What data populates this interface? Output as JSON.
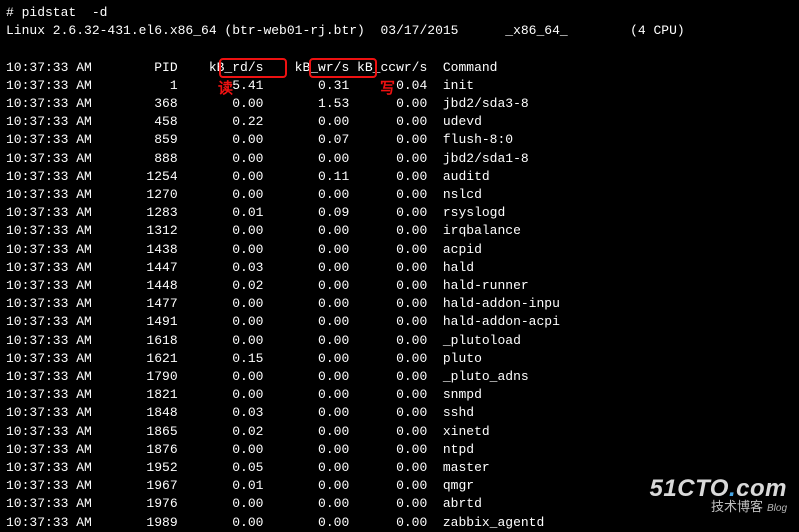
{
  "cmd": "# pidstat  -d",
  "sysline": {
    "kernel": "Linux 2.6.32-431.el6.x86_64 (btr-web01-rj.btr)",
    "date": "03/17/2015",
    "arch": "_x86_64_",
    "cpus": "(4 CPU)"
  },
  "columns": [
    "",
    "",
    "PID",
    "kB_rd/s",
    "kB_wr/s",
    "kB_ccwr/s",
    "Command"
  ],
  "annotations": {
    "read": "读",
    "write": "写"
  },
  "rows": [
    {
      "time": "10:37:33",
      "ampm": "AM",
      "pid": "1",
      "rd": "5.41",
      "wr": "0.31",
      "ccwr": "0.04",
      "cmd": "init"
    },
    {
      "time": "10:37:33",
      "ampm": "AM",
      "pid": "368",
      "rd": "0.00",
      "wr": "1.53",
      "ccwr": "0.00",
      "cmd": "jbd2/sda3-8"
    },
    {
      "time": "10:37:33",
      "ampm": "AM",
      "pid": "458",
      "rd": "0.22",
      "wr": "0.00",
      "ccwr": "0.00",
      "cmd": "udevd"
    },
    {
      "time": "10:37:33",
      "ampm": "AM",
      "pid": "859",
      "rd": "0.00",
      "wr": "0.07",
      "ccwr": "0.00",
      "cmd": "flush-8:0"
    },
    {
      "time": "10:37:33",
      "ampm": "AM",
      "pid": "888",
      "rd": "0.00",
      "wr": "0.00",
      "ccwr": "0.00",
      "cmd": "jbd2/sda1-8"
    },
    {
      "time": "10:37:33",
      "ampm": "AM",
      "pid": "1254",
      "rd": "0.00",
      "wr": "0.11",
      "ccwr": "0.00",
      "cmd": "auditd"
    },
    {
      "time": "10:37:33",
      "ampm": "AM",
      "pid": "1270",
      "rd": "0.00",
      "wr": "0.00",
      "ccwr": "0.00",
      "cmd": "nslcd"
    },
    {
      "time": "10:37:33",
      "ampm": "AM",
      "pid": "1283",
      "rd": "0.01",
      "wr": "0.09",
      "ccwr": "0.00",
      "cmd": "rsyslogd"
    },
    {
      "time": "10:37:33",
      "ampm": "AM",
      "pid": "1312",
      "rd": "0.00",
      "wr": "0.00",
      "ccwr": "0.00",
      "cmd": "irqbalance"
    },
    {
      "time": "10:37:33",
      "ampm": "AM",
      "pid": "1438",
      "rd": "0.00",
      "wr": "0.00",
      "ccwr": "0.00",
      "cmd": "acpid"
    },
    {
      "time": "10:37:33",
      "ampm": "AM",
      "pid": "1447",
      "rd": "0.03",
      "wr": "0.00",
      "ccwr": "0.00",
      "cmd": "hald"
    },
    {
      "time": "10:37:33",
      "ampm": "AM",
      "pid": "1448",
      "rd": "0.02",
      "wr": "0.00",
      "ccwr": "0.00",
      "cmd": "hald-runner"
    },
    {
      "time": "10:37:33",
      "ampm": "AM",
      "pid": "1477",
      "rd": "0.00",
      "wr": "0.00",
      "ccwr": "0.00",
      "cmd": "hald-addon-inpu"
    },
    {
      "time": "10:37:33",
      "ampm": "AM",
      "pid": "1491",
      "rd": "0.00",
      "wr": "0.00",
      "ccwr": "0.00",
      "cmd": "hald-addon-acpi"
    },
    {
      "time": "10:37:33",
      "ampm": "AM",
      "pid": "1618",
      "rd": "0.00",
      "wr": "0.00",
      "ccwr": "0.00",
      "cmd": "_plutoload"
    },
    {
      "time": "10:37:33",
      "ampm": "AM",
      "pid": "1621",
      "rd": "0.15",
      "wr": "0.00",
      "ccwr": "0.00",
      "cmd": "pluto"
    },
    {
      "time": "10:37:33",
      "ampm": "AM",
      "pid": "1790",
      "rd": "0.00",
      "wr": "0.00",
      "ccwr": "0.00",
      "cmd": "_pluto_adns"
    },
    {
      "time": "10:37:33",
      "ampm": "AM",
      "pid": "1821",
      "rd": "0.00",
      "wr": "0.00",
      "ccwr": "0.00",
      "cmd": "snmpd"
    },
    {
      "time": "10:37:33",
      "ampm": "AM",
      "pid": "1848",
      "rd": "0.03",
      "wr": "0.00",
      "ccwr": "0.00",
      "cmd": "sshd"
    },
    {
      "time": "10:37:33",
      "ampm": "AM",
      "pid": "1865",
      "rd": "0.02",
      "wr": "0.00",
      "ccwr": "0.00",
      "cmd": "xinetd"
    },
    {
      "time": "10:37:33",
      "ampm": "AM",
      "pid": "1876",
      "rd": "0.00",
      "wr": "0.00",
      "ccwr": "0.00",
      "cmd": "ntpd"
    },
    {
      "time": "10:37:33",
      "ampm": "AM",
      "pid": "1952",
      "rd": "0.05",
      "wr": "0.00",
      "ccwr": "0.00",
      "cmd": "master"
    },
    {
      "time": "10:37:33",
      "ampm": "AM",
      "pid": "1967",
      "rd": "0.01",
      "wr": "0.00",
      "ccwr": "0.00",
      "cmd": "qmgr"
    },
    {
      "time": "10:37:33",
      "ampm": "AM",
      "pid": "1976",
      "rd": "0.00",
      "wr": "0.00",
      "ccwr": "0.00",
      "cmd": "abrtd"
    },
    {
      "time": "10:37:33",
      "ampm": "AM",
      "pid": "1989",
      "rd": "0.00",
      "wr": "0.00",
      "ccwr": "0.00",
      "cmd": "zabbix_agentd"
    }
  ],
  "watermark": {
    "site": "51CTO",
    "dot": ".",
    "suffix": "com",
    "sub": "技术博客",
    "blog": "Blog"
  }
}
